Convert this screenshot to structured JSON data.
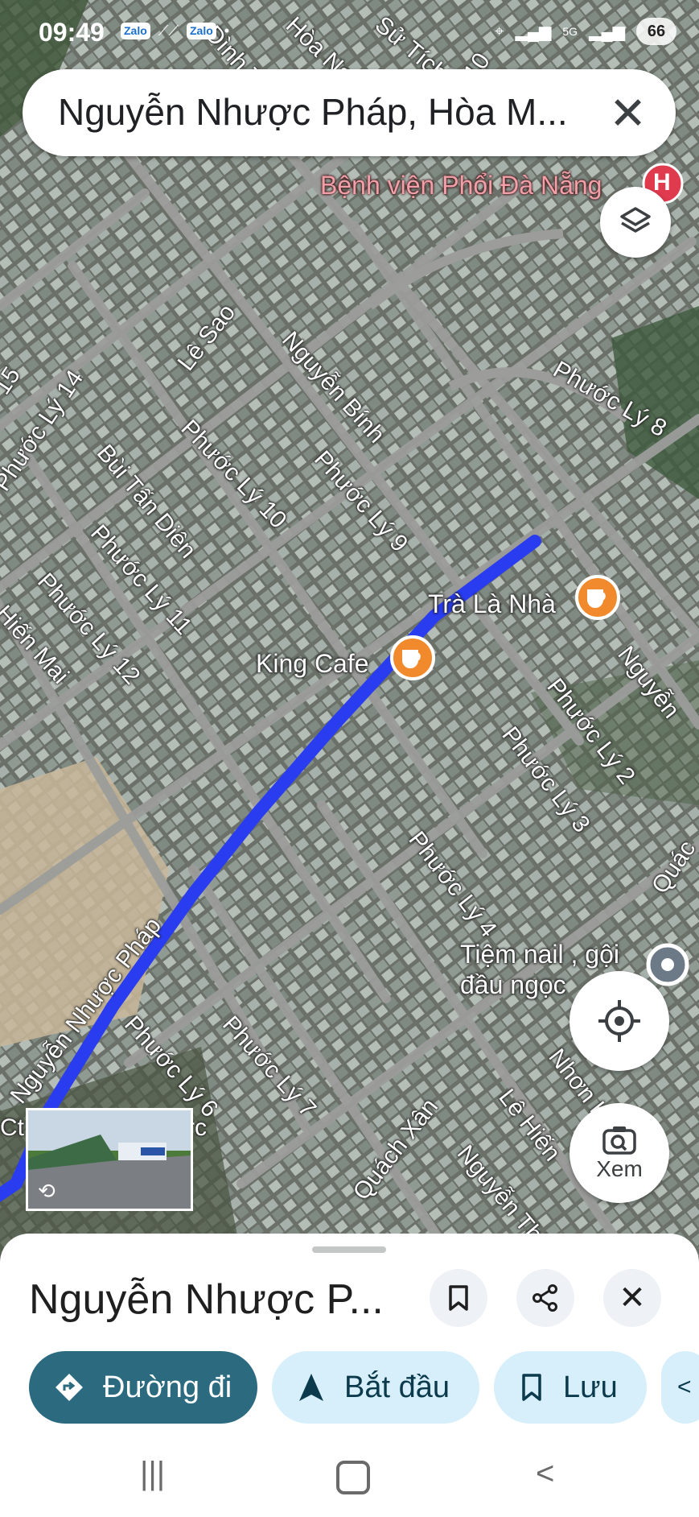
{
  "status_bar": {
    "time": "09:49",
    "app_badges": [
      "Zalo",
      "Zalo"
    ],
    "network": "5G",
    "battery": "66"
  },
  "search": {
    "query": "Nguyễn Nhược Pháp, Hòa M...",
    "close_icon": "close-icon"
  },
  "map": {
    "hospital_label": "Bệnh viện Phổi Đà Nẵng",
    "hospital_marker": "H",
    "road_labels": [
      "Nguyễn Bính",
      "Phước Lý 8",
      "Lê Sao",
      "Phước Lý 10",
      "Phước Lý 9",
      "Phước Lý 14",
      "Bùi Tấn Diên",
      "Phước Lý 11",
      "Phước Lý 12",
      "Hiến Mai",
      "Phước Lý 2",
      "Phước Lý 3",
      "Phước Lý 4",
      "Nguyễn Nhược Pháp",
      "Phước Lý 6",
      "Phước Lý 7",
      "Quách Xân",
      "Nguyễn Thị",
      "Lê Hiến",
      "Nhơn Hòa",
      "Nguyễn",
      "Quác",
      "15",
      "Đình T",
      "Hòa Nam",
      "Sử Tích",
      "10",
      "rc",
      "Ct"
    ],
    "pois": [
      {
        "name": "Trà Là Nhà",
        "icon": "coffee-icon"
      },
      {
        "name": "King Cafe",
        "icon": "coffee-icon"
      },
      {
        "name": "Tiệm nail , gội đầu ngọc",
        "icon": "pin-icon"
      }
    ],
    "colors": {
      "route": "#2a3cf0",
      "poi": "#f08a2c",
      "hospital": "#e03a4e"
    }
  },
  "buttons": {
    "layers_icon": "layers-icon",
    "my_location_icon": "my-location-icon",
    "lens_label": "Xem"
  },
  "street_view": {
    "icon": "street-view-rotate-icon"
  },
  "sheet": {
    "title": "Nguyễn Nhược P...",
    "save_icon": "bookmark-icon",
    "share_icon": "share-icon",
    "close_icon": "close-icon",
    "chips": [
      {
        "label": "Đường đi",
        "icon": "directions-icon"
      },
      {
        "label": "Bắt đầu",
        "icon": "navigation-arrow-icon"
      },
      {
        "label": "Lưu",
        "icon": "bookmark-icon"
      }
    ]
  },
  "nav": {
    "recents": "recents-icon",
    "home": "home-icon",
    "back": "back-icon"
  }
}
